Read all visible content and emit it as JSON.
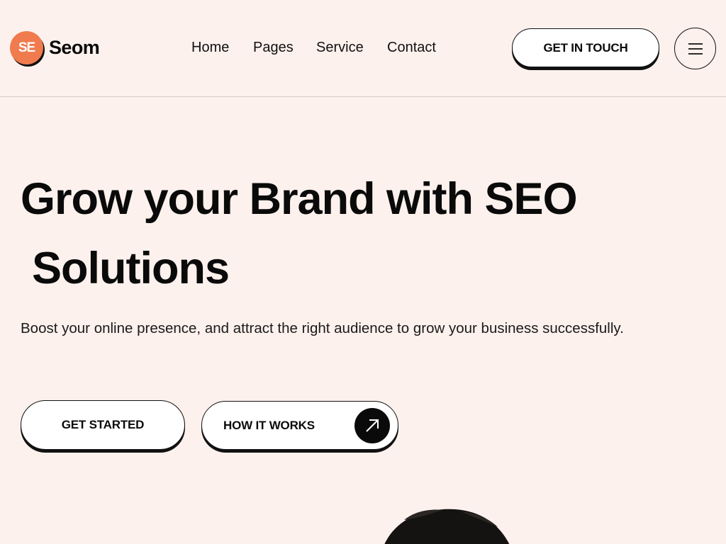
{
  "brand": {
    "logo_text": "Seom",
    "logo_initials": "SE",
    "accent_color": "#f07b4f"
  },
  "nav": {
    "items": [
      {
        "label": "Home"
      },
      {
        "label": "Pages"
      },
      {
        "label": "Service"
      },
      {
        "label": "Contact"
      }
    ],
    "cta_label": "GET IN TOUCH",
    "menu_icon": "hamburger-icon"
  },
  "hero": {
    "title_line1": "Grow your Brand with SEO",
    "title_line2": "Solutions",
    "subtitle": "Boost your online presence, and attract the right audience to grow your business successfully.",
    "primary_button": "GET STARTED",
    "secondary_button": "HOW IT WORKS",
    "secondary_icon": "arrow-up-right-icon"
  },
  "colors": {
    "background": "#fcf1ed",
    "text": "#0a0a0a"
  }
}
